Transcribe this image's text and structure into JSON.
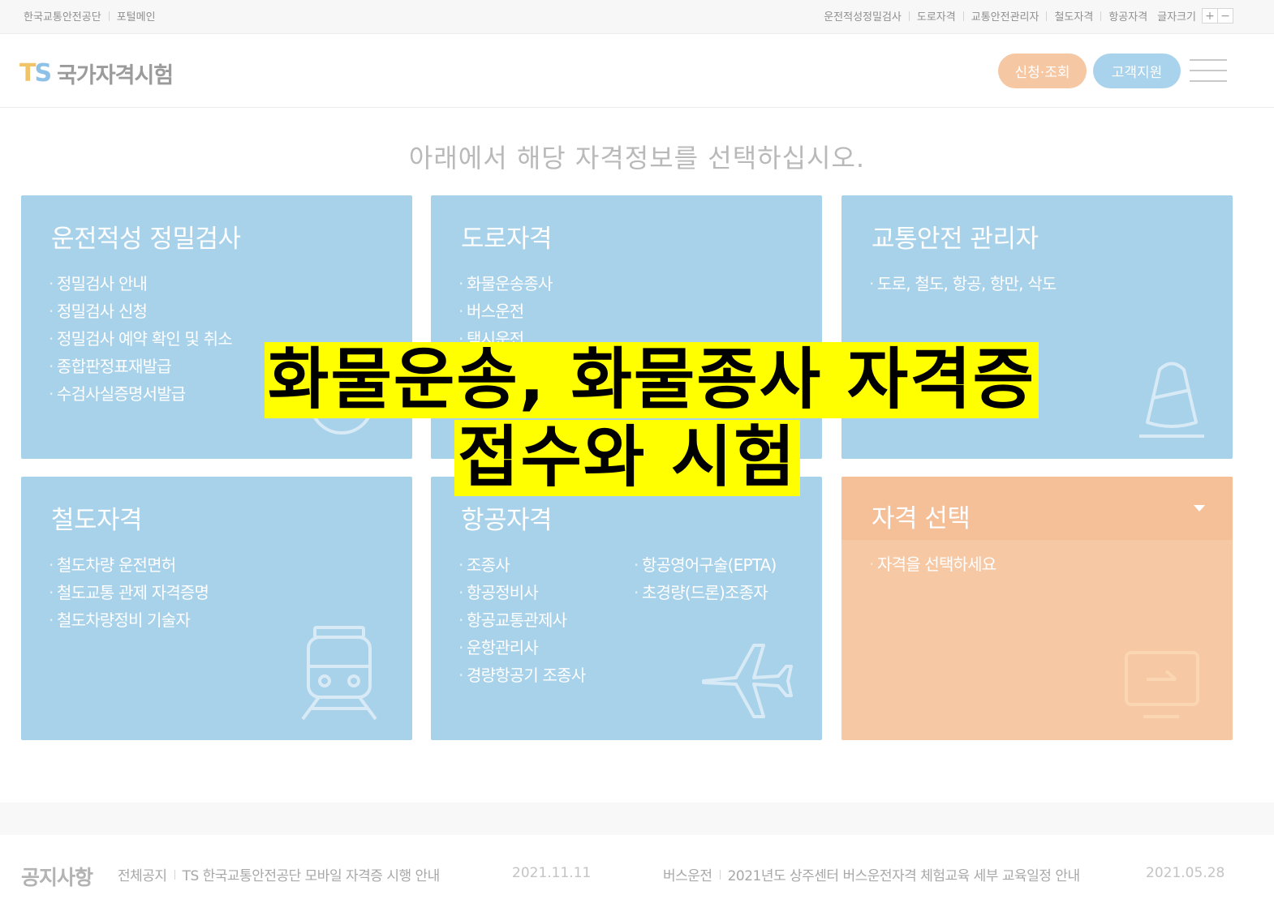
{
  "topbar": {
    "left": [
      "한국교통안전공단",
      "포털메인"
    ],
    "right": [
      "운전적성정밀검사",
      "도로자격",
      "교통안전관리자",
      "철도자격",
      "항공자격"
    ],
    "font_size_label": "글자크기",
    "font_plus": "+",
    "font_minus": "−"
  },
  "header": {
    "logo_ts_t": "T",
    "logo_ts_s": "S",
    "logo_text": "국가자격시험",
    "apply_button": "신청·조회",
    "support_button": "고객지원"
  },
  "heading": "아래에서 해당 자격정보를 선택하십시오.",
  "cards": {
    "aptitude": {
      "title": "운전적성 정밀검사",
      "items": [
        "정밀검사 안내",
        "정밀검사 신청",
        "정밀검사 예약 확인 및 취소",
        "종합판정표재발급",
        "수검사실증명서발급"
      ]
    },
    "road": {
      "title": "도로자격",
      "items": [
        "화물운송종사",
        "버스운전",
        "택시운전"
      ]
    },
    "safety_manager": {
      "title": "교통안전 관리자",
      "items": [
        "도로, 철도, 항공, 항만, 삭도"
      ]
    },
    "rail": {
      "title": "철도자격",
      "items": [
        "철도차량 운전면허",
        "철도교통 관제 자격증명",
        "철도차량정비 기술자"
      ]
    },
    "aviation": {
      "title": "항공자격",
      "items_col1": [
        "조종사",
        "항공정비사",
        "항공교통관제사",
        "운항관리사",
        "경량항공기 조종사"
      ],
      "items_col2": [
        "항공영어구술(EPTA)",
        "초경량(드론)조종자"
      ]
    },
    "select": {
      "title": "자격 선택",
      "items": [
        "자격을 선택하세요"
      ]
    }
  },
  "notice": {
    "title": "공지사항",
    "items": [
      {
        "category": "전체공지",
        "text": "TS 한국교통안전공단 모바일 자격증 시행 안내",
        "date": "2021.11.11"
      },
      {
        "category": "버스운전",
        "text": "2021년도 상주센터 버스운전자격 체험교육 세부 교육일정 안내",
        "date": "2021.05.28"
      }
    ]
  },
  "caption": {
    "line1": "화물운송, 화물종사 자격증",
    "line2": "접수와 시험"
  },
  "colors": {
    "card_blue": "#a8d2ea",
    "card_orange": "#f7c8a4",
    "caption_bg": "#ffff00"
  },
  "icons": [
    "steering-wheel-icon",
    "traffic-cone-icon",
    "train-icon",
    "airplane-icon",
    "monitor-icon",
    "hamburger-menu-icon"
  ]
}
